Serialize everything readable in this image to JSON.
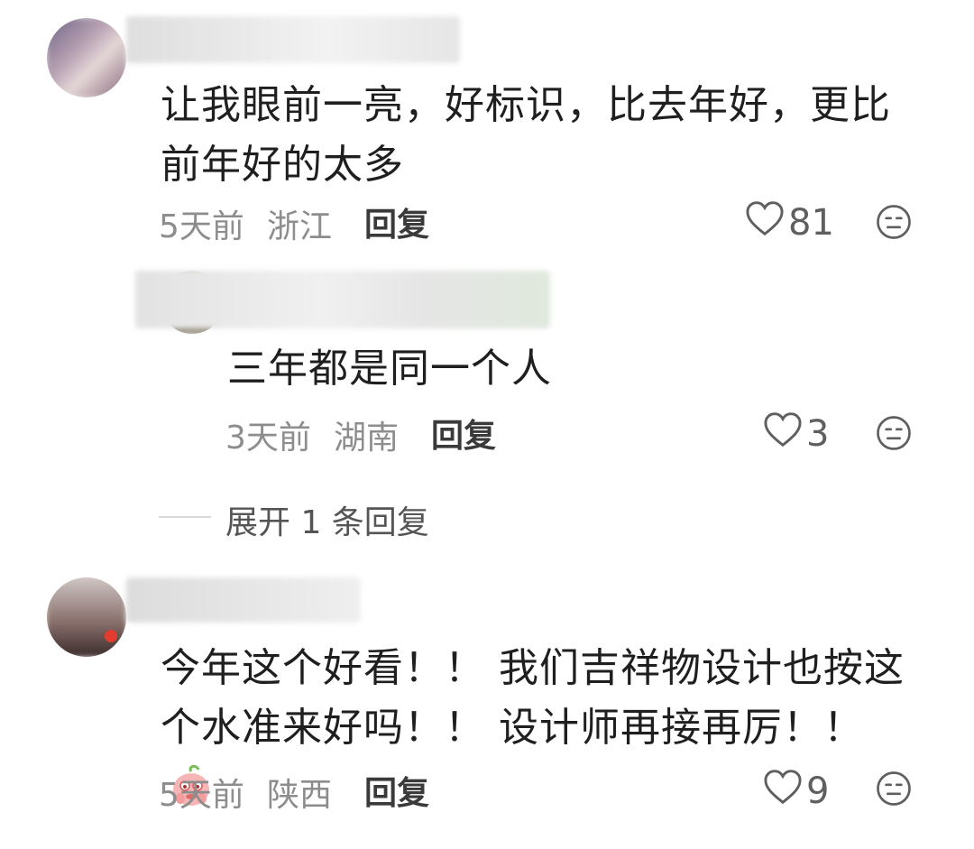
{
  "comments": [
    {
      "text": "让我眼前一亮，好标识，比去年好，更比前年好的太多",
      "time": "5天前",
      "location": "浙江",
      "reply_label": "回复",
      "likes": "81"
    },
    {
      "text": "三年都是同一个人",
      "time": "3天前",
      "location": "湖南",
      "reply_label": "回复",
      "likes": "3"
    },
    {
      "text": "今年这个好看！！ 我们吉祥物设计也按这个水准来好吗！！ 设计师再接再厉！！",
      "time": "5天前",
      "location": "陕西",
      "reply_label": "回复",
      "likes": "9"
    }
  ],
  "expand_replies": "展开 1 条回复",
  "icons": [
    "heart-icon",
    "dislike-face-icon",
    "peach-emoji-icon"
  ]
}
